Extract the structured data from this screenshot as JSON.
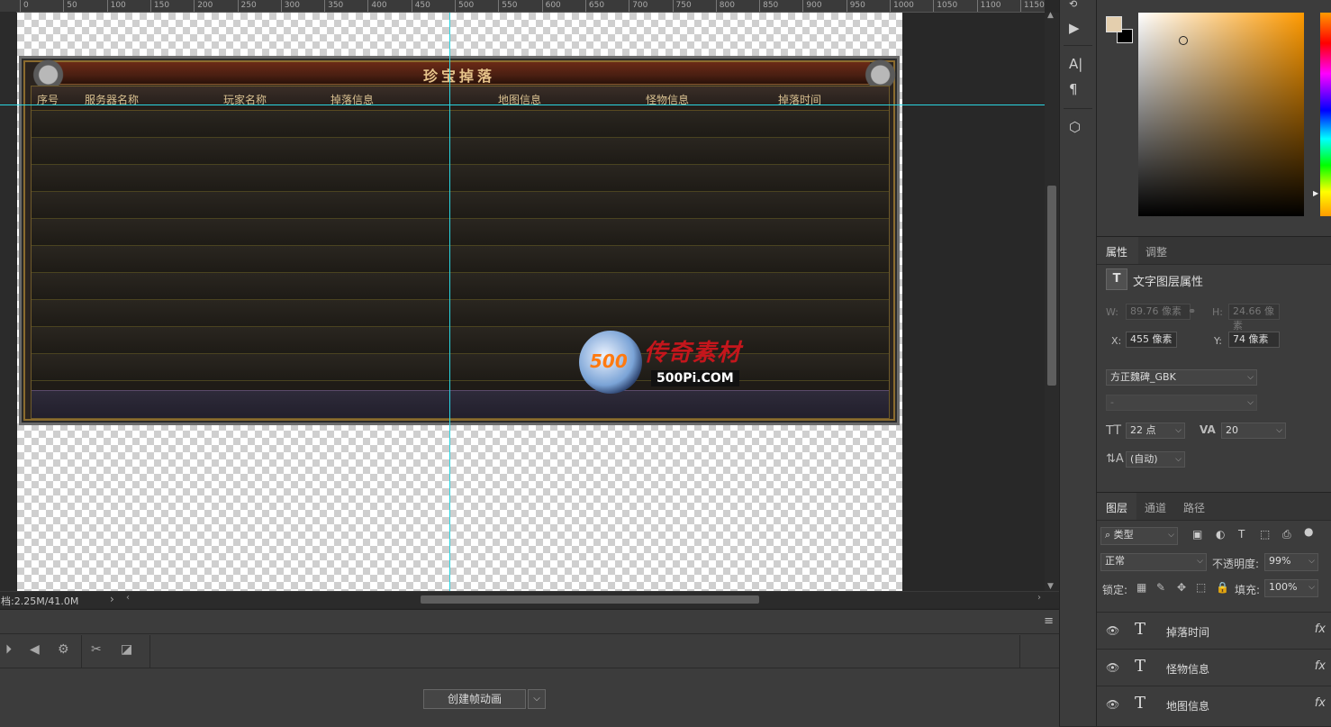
{
  "ruler": {
    "labels": [
      "0",
      "50",
      "100",
      "150",
      "200",
      "250",
      "300",
      "350",
      "400",
      "450",
      "500",
      "550",
      "600",
      "650",
      "700",
      "750",
      "800",
      "850",
      "900",
      "950",
      "1000",
      "1050",
      "1100",
      "1150"
    ]
  },
  "canvas": {
    "frame_title": "珍宝掉落",
    "columns": [
      "序号",
      "服务器名称",
      "玩家名称",
      "掉落信息",
      "地图信息",
      "怪物信息",
      "掉落时间"
    ],
    "row_count": 10,
    "watermark": {
      "mark": "500",
      "cn": "传奇素材",
      "en": "500Pi.COM"
    }
  },
  "status": {
    "doc_size": "档:2.25M/41.0M",
    "arrow": "›"
  },
  "timeline": {
    "create_button": "创建帧动画",
    "dropdown": "⌵"
  },
  "tools": {
    "type_tool": "A|",
    "paragraph": "¶",
    "cube": "⬡",
    "play": "▶"
  },
  "color": {
    "foreground": "#e4cfae",
    "background": "#000000",
    "hue": "#ff9a00"
  },
  "properties": {
    "tabs": [
      "属性",
      "调整"
    ],
    "title_icon": "T",
    "title": "文字图层属性",
    "w_label": "W:",
    "w_value": "89.76 像素",
    "h_label": "H:",
    "h_value": "24.66 像素",
    "x_label": "X:",
    "x_value": "455 像素",
    "y_label": "Y:",
    "y_value": "74 像素",
    "font_family": "方正魏碑_GBK",
    "font_style": "-",
    "font_size": "22 点",
    "tracking": "20",
    "leading": "(自动)"
  },
  "layers": {
    "tabs": [
      "图层",
      "通道",
      "路径"
    ],
    "filter": "类型",
    "blend_mode": "正常",
    "opacity_label": "不透明度:",
    "opacity": "99%",
    "lock_label": "锁定:",
    "fill_label": "填充:",
    "fill": "100%",
    "items": [
      {
        "name": "掉落时间",
        "fx": "fx"
      },
      {
        "name": "怪物信息",
        "fx": "fx"
      },
      {
        "name": "地图信息",
        "fx": "fx"
      }
    ]
  }
}
